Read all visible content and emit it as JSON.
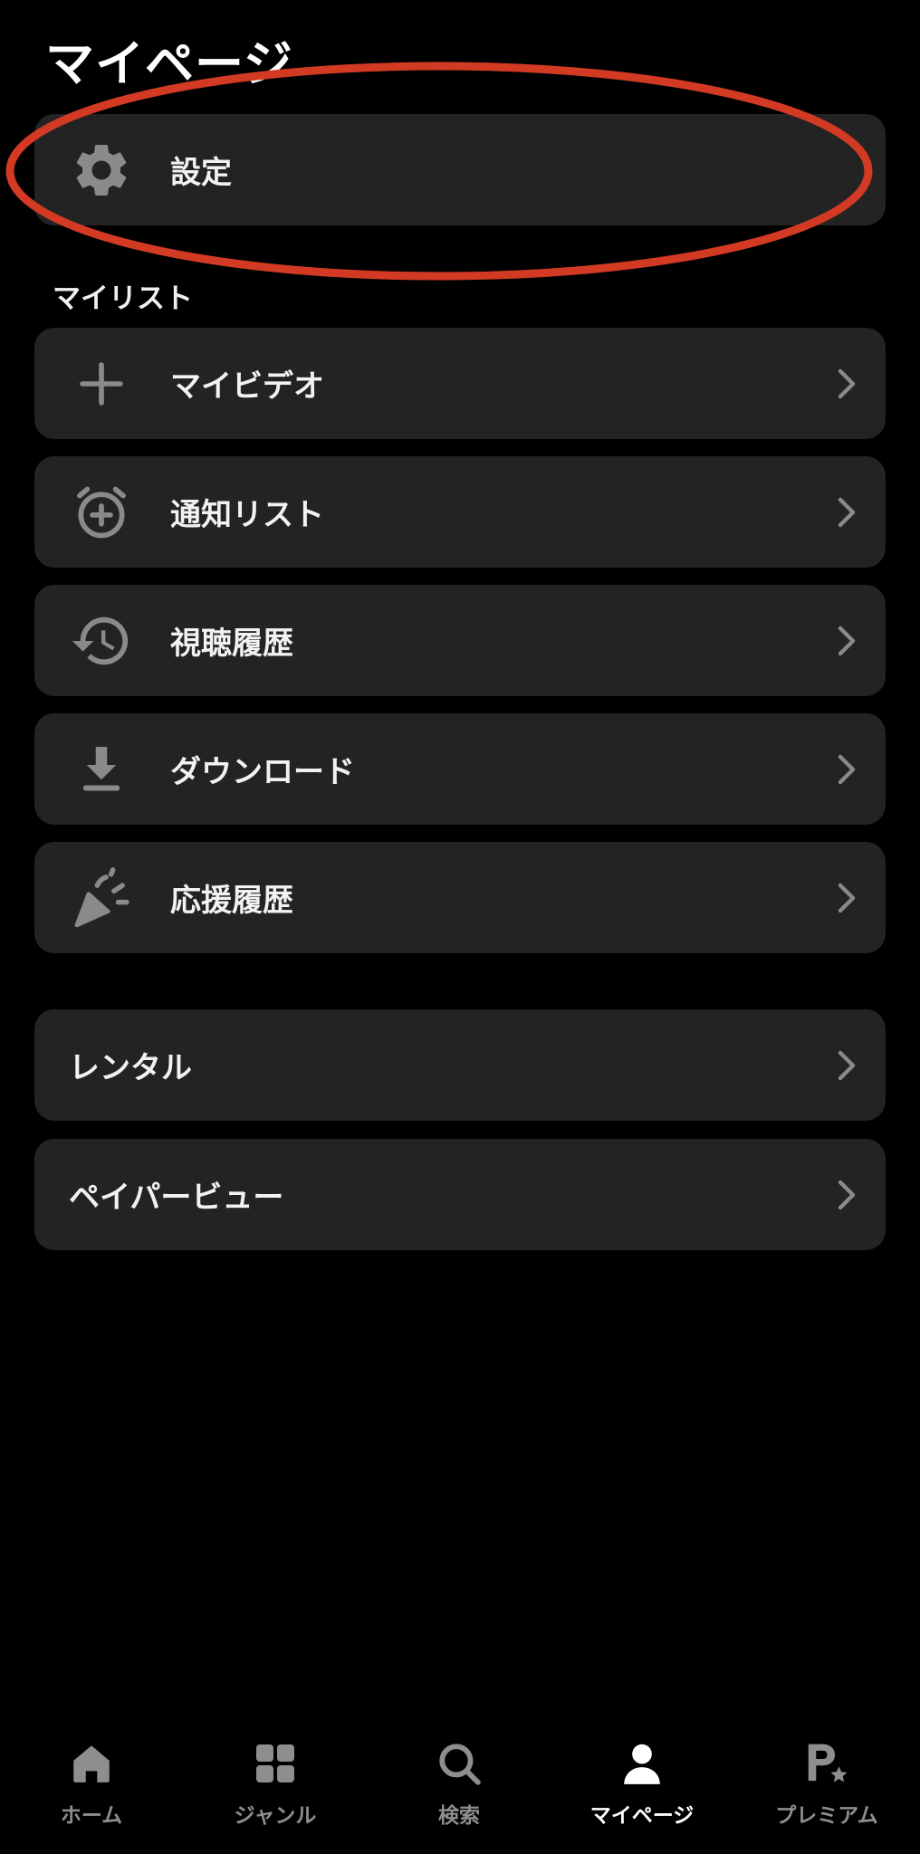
{
  "page": {
    "title": "マイページ"
  },
  "settings": {
    "label": "設定",
    "highlighted": true,
    "highlight_color": "#d23a24"
  },
  "mylist": {
    "section_label": "マイリスト",
    "items": [
      {
        "label": "マイビデオ",
        "icon": "plus-icon"
      },
      {
        "label": "通知リスト",
        "icon": "alarm-add-icon"
      },
      {
        "label": "視聴履歴",
        "icon": "history-icon"
      },
      {
        "label": "ダウンロード",
        "icon": "download-icon"
      },
      {
        "label": "応援履歴",
        "icon": "party-popper-icon"
      }
    ]
  },
  "other": {
    "items": [
      {
        "label": "レンタル"
      },
      {
        "label": "ペイパービュー"
      }
    ]
  },
  "tabbar": {
    "active": "マイページ",
    "tabs": [
      {
        "label": "ホーム",
        "icon": "home-icon"
      },
      {
        "label": "ジャンル",
        "icon": "grid-icon"
      },
      {
        "label": "検索",
        "icon": "search-icon"
      },
      {
        "label": "マイページ",
        "icon": "person-icon"
      },
      {
        "label": "プレミアム",
        "icon": "premium-p-star-icon"
      }
    ]
  },
  "colors": {
    "background": "#000000",
    "card": "#232323",
    "icon_gray": "#8a8a8a",
    "tab_inactive": "#8e8e8e",
    "tab_active": "#ffffff"
  }
}
